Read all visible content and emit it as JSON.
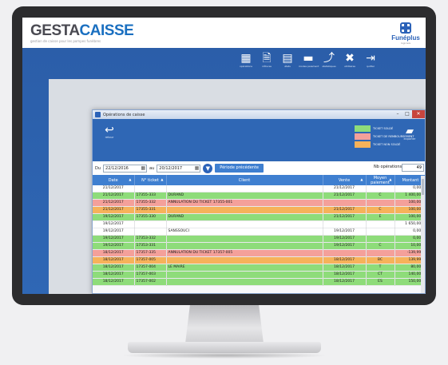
{
  "header": {
    "logo_part1": "GESTA",
    "logo_part2": "CAISSE",
    "tagline": "gestion de caisse pour les pompes funèbres",
    "brand_name": "Funéplus",
    "brand_sub": "logiciels"
  },
  "toolbar": [
    {
      "icon": "grid-icon",
      "glyph": "▦",
      "label": "opérations"
    },
    {
      "icon": "receipt-icon",
      "glyph": "🗎",
      "label": "clôtures"
    },
    {
      "icon": "print-icon",
      "glyph": "▤",
      "label": "états"
    },
    {
      "icon": "card-icon",
      "glyph": "▬",
      "label": "modes paiement"
    },
    {
      "icon": "chart-icon",
      "glyph": "⤴",
      "label": "statistiques"
    },
    {
      "icon": "tools-icon",
      "glyph": "✖",
      "label": "utilitaires"
    },
    {
      "icon": "exit-icon",
      "glyph": "⇥",
      "label": "quitter"
    }
  ],
  "dialog": {
    "title": "Opérations de caisse",
    "back_label": "retour",
    "export_label": "exporter",
    "legend": [
      {
        "label": "TICKET SOLDÉ",
        "color": "#8edc7a"
      },
      {
        "label": "TICKET DE REMBOURSEMENT",
        "color": "#f4a09a"
      },
      {
        "label": "TICKET NON SOLDÉ",
        "color": "#f6b25a"
      }
    ]
  },
  "filters": {
    "du_label": "Du",
    "date_from": "22/12/2016",
    "au_label": "au",
    "date_to": "20/12/2017",
    "periode_btn": "Période précédente",
    "nb_label": "Nb opérations",
    "nb_value": "49"
  },
  "table": {
    "headers": [
      "Date",
      "N° ticket",
      "Client",
      "Vente",
      "Moyen paiement",
      "Montant"
    ],
    "rows": [
      {
        "c": "w",
        "date": "21/12/2017",
        "num": "",
        "client": "",
        "vente": "21/12/2017",
        "mode": "",
        "amt": "0,00 €"
      },
      {
        "c": "g",
        "date": "21/12/2017",
        "num": "17355-333",
        "client": "DURAND",
        "vente": "21/12/2017",
        "mode": "C",
        "amt": "1 400,00 €"
      },
      {
        "c": "r",
        "date": "21/12/2017",
        "num": "17355-332",
        "client": "ANNULATION DU TICKET 17355-001",
        "vente": "",
        "mode": "",
        "amt": "100,00 €"
      },
      {
        "c": "o",
        "date": "21/12/2017",
        "num": "17355-331",
        "client": "",
        "vente": "21/12/2017",
        "mode": "C",
        "amt": "100,00 €"
      },
      {
        "c": "g",
        "date": "19/12/2017",
        "num": "17355-330",
        "client": "DURAND",
        "vente": "21/12/2017",
        "mode": "E",
        "amt": "100,00 €"
      },
      {
        "c": "w",
        "date": "19/12/2017",
        "num": "",
        "client": "",
        "vente": "",
        "mode": "",
        "amt": "1 650,00 €"
      },
      {
        "c": "w",
        "date": "19/12/2017",
        "num": "",
        "client": "SANSSOUCI",
        "vente": "19/12/2017",
        "mode": "",
        "amt": "0,00 €"
      },
      {
        "c": "g",
        "date": "19/12/2017",
        "num": "17353-332",
        "client": "",
        "vente": "19/12/2017",
        "mode": "",
        "amt": "0,00 €"
      },
      {
        "c": "g",
        "date": "19/12/2017",
        "num": "17353-331",
        "client": "",
        "vente": "19/12/2017",
        "mode": "C",
        "amt": "10,00 €"
      },
      {
        "c": "r",
        "date": "18/12/2017",
        "num": "17357-335",
        "client": "ANNULATION DU TICKET 17357-005",
        "vente": "",
        "mode": "",
        "amt": "-139,99 €"
      },
      {
        "c": "o",
        "date": "18/12/2017",
        "num": "17357-005",
        "client": "",
        "vente": "18/12/2017",
        "mode": "BC",
        "amt": "139,99 €"
      },
      {
        "c": "g",
        "date": "18/12/2017",
        "num": "17357-004",
        "client": "LE MAIRE",
        "vente": "18/12/2017",
        "mode": "T",
        "amt": "80,00 €"
      },
      {
        "c": "g",
        "date": "18/12/2017",
        "num": "17357-003",
        "client": "",
        "vente": "18/12/2017",
        "mode": "CT",
        "amt": "140,00 €"
      },
      {
        "c": "g",
        "date": "18/12/2017",
        "num": "17357-002",
        "client": "",
        "vente": "18/12/2017",
        "mode": "ES",
        "amt": "150,00 €"
      }
    ]
  }
}
